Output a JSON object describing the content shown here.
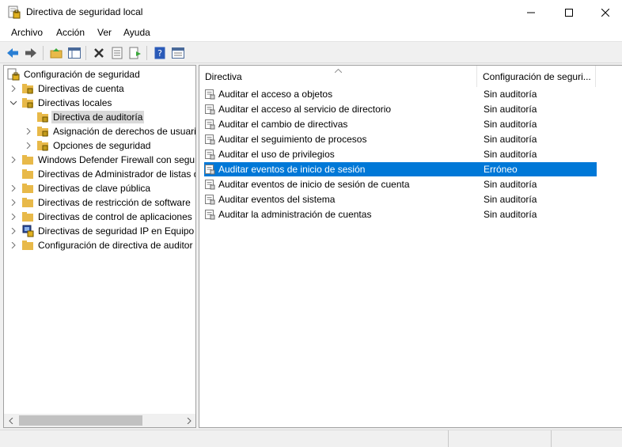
{
  "window": {
    "title": "Directiva de seguridad local"
  },
  "menu": [
    "Archivo",
    "Acción",
    "Ver",
    "Ayuda"
  ],
  "tree": {
    "root": "Configuración de seguridad",
    "items": [
      {
        "label": "Directivas de cuenta"
      },
      {
        "label": "Directivas locales"
      },
      {
        "label": "Directiva de auditoría"
      },
      {
        "label": "Asignación de derechos de usuari"
      },
      {
        "label": "Opciones de seguridad"
      },
      {
        "label": "Windows Defender Firewall con segur"
      },
      {
        "label": "Directivas de Administrador de listas d"
      },
      {
        "label": "Directivas de clave pública"
      },
      {
        "label": "Directivas de restricción de software"
      },
      {
        "label": "Directivas de control de aplicaciones"
      },
      {
        "label": "Directivas de seguridad IP en Equipo l"
      },
      {
        "label": "Configuración de directiva de auditor"
      }
    ]
  },
  "list": {
    "columns": [
      "Directiva",
      "Configuración de seguri..."
    ],
    "rows": [
      {
        "name": "Auditar el acceso a objetos",
        "value": "Sin auditoría"
      },
      {
        "name": "Auditar el acceso al servicio de directorio",
        "value": "Sin auditoría"
      },
      {
        "name": "Auditar el cambio de directivas",
        "value": "Sin auditoría"
      },
      {
        "name": "Auditar el seguimiento de procesos",
        "value": "Sin auditoría"
      },
      {
        "name": "Auditar el uso de privilegios",
        "value": "Sin auditoría"
      },
      {
        "name": "Auditar eventos de inicio de sesión",
        "value": "Erróneo"
      },
      {
        "name": "Auditar eventos de inicio de sesión de cuenta",
        "value": "Sin auditoría"
      },
      {
        "name": "Auditar eventos del sistema",
        "value": "Sin auditoría"
      },
      {
        "name": "Auditar la administración de cuentas",
        "value": "Sin auditoría"
      }
    ]
  },
  "colors": {
    "selection": "#0078d7",
    "folder": "#e8b949"
  }
}
